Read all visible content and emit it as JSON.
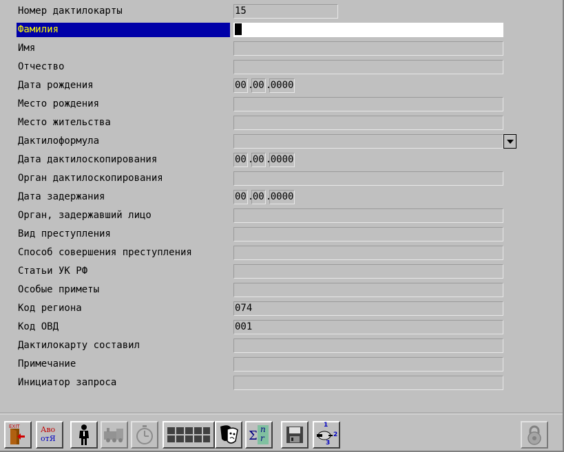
{
  "form": {
    "rows": [
      {
        "label": "Номер дактилокарты",
        "value": "15",
        "kind": "short"
      },
      {
        "label": "Фамилия",
        "value": "",
        "kind": "active"
      },
      {
        "label": "Имя",
        "value": "",
        "kind": "text"
      },
      {
        "label": "Отчество",
        "value": "",
        "kind": "text"
      },
      {
        "label": "Дата рождения",
        "kind": "date",
        "date": [
          "00",
          "00",
          "0000"
        ]
      },
      {
        "label": "Место рождения",
        "value": "",
        "kind": "text"
      },
      {
        "label": "Место жительства",
        "value": "",
        "kind": "text"
      },
      {
        "label": "Дактилоформула",
        "value": "",
        "kind": "combo"
      },
      {
        "label": "Дата дактилоскопирования",
        "kind": "date",
        "date": [
          "00",
          "00",
          "0000"
        ]
      },
      {
        "label": "Орган дактилоскопирования",
        "value": "",
        "kind": "text"
      },
      {
        "label": "Дата задержания",
        "kind": "date",
        "date": [
          "00",
          "00",
          "0000"
        ]
      },
      {
        "label": "Орган, задержавший лицо",
        "value": "",
        "kind": "text"
      },
      {
        "label": "Вид преступления",
        "value": "",
        "kind": "text"
      },
      {
        "label": "Способ совершения преступления",
        "value": "",
        "kind": "text"
      },
      {
        "label": "Статьи УК РФ",
        "value": "",
        "kind": "text"
      },
      {
        "label": "Особые приметы",
        "value": "",
        "kind": "text"
      },
      {
        "label": "Код региона",
        "value": "074",
        "kind": "text"
      },
      {
        "label": "Код ОВД",
        "value": "001",
        "kind": "text"
      },
      {
        "label": "Дактилокарту составил",
        "value": "",
        "kind": "text"
      },
      {
        "label": "Примечание",
        "value": "",
        "kind": "text"
      },
      {
        "label": "Инициатор запроса",
        "value": "",
        "kind": "text"
      }
    ]
  },
  "toolbar": {
    "exit_label": "EXIT",
    "translit": {
      "top": "Аво",
      "bottom": "отЯ"
    },
    "sigma": {
      "sym": "Σ",
      "n": "n",
      "r": "r"
    },
    "steps": {
      "one": "1",
      "two": "2",
      "three": "3"
    },
    "icons": [
      "exit-icon",
      "translit-icon",
      "person-icon",
      "train-icon",
      "stopwatch-icon",
      "grid-icon",
      "masks-icon",
      "sigma-icon",
      "floppy-icon",
      "steps-icon",
      "lock-icon"
    ]
  },
  "colors": {
    "background": "#c0c0c0",
    "active_label_bg": "#0000a8",
    "active_label_fg": "#ffff00",
    "active_field_bg": "#ffffff"
  }
}
